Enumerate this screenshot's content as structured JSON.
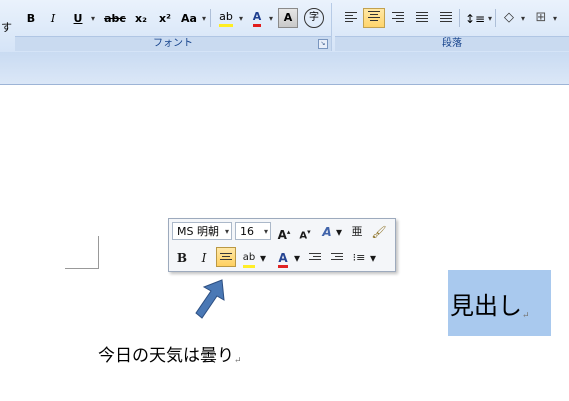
{
  "ribbon": {
    "left_edge_glyph": "す",
    "font_group": {
      "label": "フォント",
      "bold": "B",
      "italic": "I",
      "underline": "U",
      "strikethrough": "abc",
      "subscript": "x₂",
      "superscript": "x²",
      "change_case": "Aa",
      "highlight": "ab",
      "font_color": "A",
      "char_shading": "A",
      "enclose": "字"
    },
    "paragraph_group": {
      "label": "段落"
    }
  },
  "mini_toolbar": {
    "font_name": "MS 明朝",
    "font_size": "16",
    "grow_font": "A",
    "shrink_font": "A",
    "styles": "A",
    "phonetic": "亜",
    "bold": "B",
    "italic": "I",
    "highlight": "ab",
    "font_color": "A"
  },
  "document": {
    "body_text": "今日の天気は曇り",
    "heading_text": "見出し",
    "paragraph_mark": "↵"
  },
  "colors": {
    "accent_highlight": "#ffd46b",
    "font_color_red": "#e11d1d",
    "highlight_yellow": "#ffee22",
    "heading_selection": "#a9c9ee",
    "arrow_blue": "#4a78b5"
  }
}
